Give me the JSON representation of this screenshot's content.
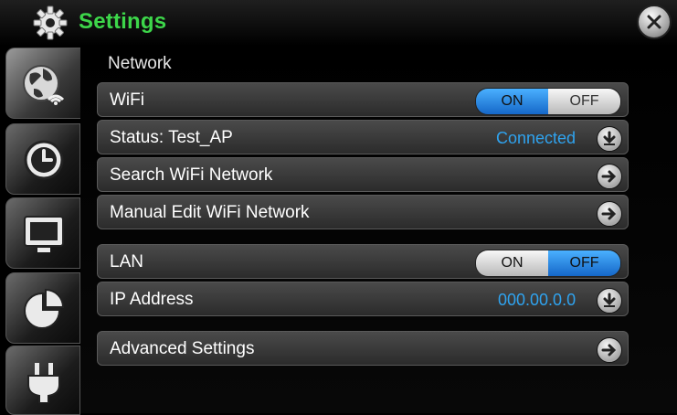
{
  "window": {
    "title": "Settings",
    "title_color": "#3dd64a"
  },
  "sidebar": {
    "tabs": [
      {
        "name": "network",
        "icon": "globe-wifi-icon",
        "active": true
      },
      {
        "name": "time",
        "icon": "clock-icon",
        "active": false
      },
      {
        "name": "display",
        "icon": "monitor-icon",
        "active": false
      },
      {
        "name": "storage",
        "icon": "pie-chart-icon",
        "active": false
      },
      {
        "name": "power",
        "icon": "plug-icon",
        "active": false
      }
    ]
  },
  "main": {
    "section_title": "Network",
    "wifi": {
      "label": "WiFi",
      "on_label": "ON",
      "off_label": "OFF",
      "state": "on"
    },
    "status": {
      "label": "Status: Test_AP",
      "value": "Connected",
      "icon": "download-circle-icon"
    },
    "search": {
      "label": "Search WiFi Network",
      "icon": "arrow-right-circle-icon"
    },
    "manual": {
      "label": "Manual Edit WiFi Network",
      "icon": "arrow-right-circle-icon"
    },
    "lan": {
      "label": "LAN",
      "on_label": "ON",
      "off_label": "OFF",
      "state": "off"
    },
    "ip": {
      "label": "IP Address",
      "value": "000.00.0.0",
      "icon": "download-circle-icon"
    },
    "advanced": {
      "label": "Advanced Settings",
      "icon": "arrow-right-circle-icon"
    }
  },
  "colors": {
    "accent_blue": "#2fa3ef",
    "toggle_on": "#1f86e6",
    "panel": "#3a3a3a"
  }
}
